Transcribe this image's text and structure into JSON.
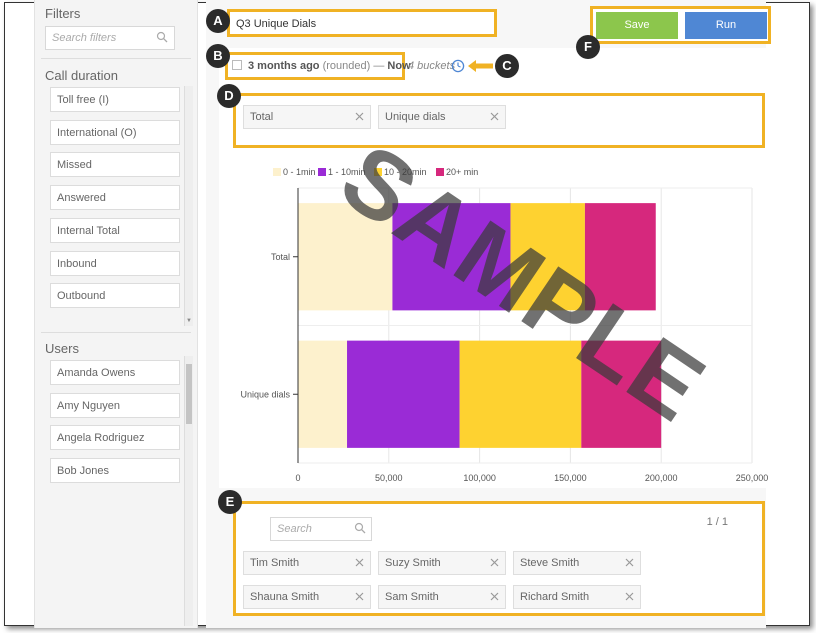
{
  "sidebar": {
    "filters_title": "Filters",
    "search_placeholder": "Search filters",
    "call_duration_title": "Call duration",
    "call_duration_items": [
      "Toll free (I)",
      "International (O)",
      "Missed",
      "Answered",
      "Internal Total",
      "Inbound",
      "Outbound"
    ],
    "users_title": "Users",
    "users_items": [
      "Amanda Owens",
      "Amy Nguyen",
      "Angela Rodriguez",
      "Bob Jones"
    ]
  },
  "header": {
    "report_title": "Q3 Unique Dials",
    "save_label": "Save",
    "run_label": "Run"
  },
  "date_range": {
    "from": "3 months ago",
    "rounded": "(rounded)",
    "separator": "—",
    "to": "Now",
    "buckets": "4 buckets"
  },
  "series_selector": [
    "Total",
    "Unique dials"
  ],
  "markers": [
    "A",
    "B",
    "C",
    "D",
    "E",
    "F"
  ],
  "watermark": "SAMPLE",
  "users_panel": {
    "search_placeholder": "Search",
    "pager": "1 / 1",
    "chips": [
      "Tim Smith",
      "Suzy Smith",
      "Steve Smith",
      "Shauna Smith",
      "Sam Smith",
      "Richard Smith"
    ]
  },
  "colors": {
    "accent_outline": "#f0b224",
    "save": "#8cc64c",
    "run": "#4f87d4",
    "bucket_0_1": "#fdf1cd",
    "bucket_1_10": "#9a2bd6",
    "bucket_10_20": "#fed230",
    "bucket_20_plus": "#d6287d"
  },
  "chart_data": {
    "type": "bar",
    "orientation": "horizontal",
    "stacked": true,
    "categories": [
      "Total",
      "Unique dials"
    ],
    "series": [
      {
        "name": "0 - 1min",
        "values": [
          52000,
          27000
        ]
      },
      {
        "name": "1 - 10min",
        "values": [
          65000,
          62000
        ]
      },
      {
        "name": "10 - 20min",
        "values": [
          41000,
          67000
        ]
      },
      {
        "name": "20+ min",
        "values": [
          39000,
          44000
        ]
      }
    ],
    "xlim": [
      0,
      250000
    ],
    "xticks": [
      0,
      50000,
      100000,
      150000,
      200000,
      250000
    ],
    "xtick_labels": [
      "0",
      "50,000",
      "100,000",
      "150,000",
      "200,000",
      "250,000"
    ],
    "legend_position": "top-left",
    "grid": true
  }
}
